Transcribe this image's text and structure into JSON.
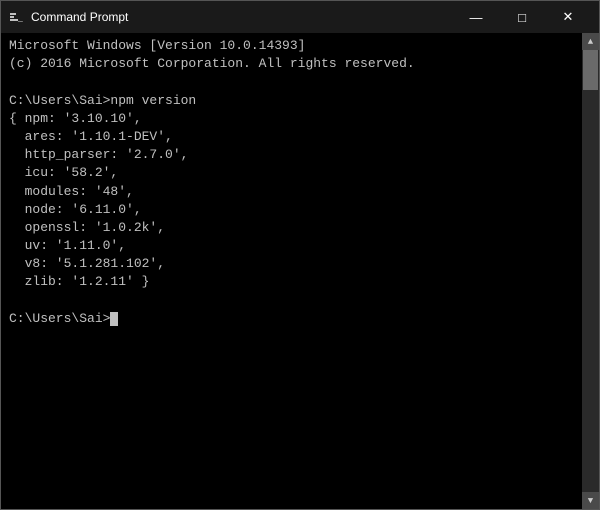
{
  "window": {
    "title": "Command Prompt",
    "controls": {
      "minimize": "—",
      "maximize": "□",
      "close": "✕"
    }
  },
  "terminal": {
    "lines": [
      "Microsoft Windows [Version 10.0.14393]",
      "(c) 2016 Microsoft Corporation. All rights reserved.",
      "",
      "C:\\Users\\Sai>npm version",
      "{ npm: '3.10.10',",
      "  ares: '1.10.1-DEV',",
      "  http_parser: '2.7.0',",
      "  icu: '58.2',",
      "  modules: '48',",
      "  node: '6.11.0',",
      "  openssl: '1.0.2k',",
      "  uv: '1.11.0',",
      "  v8: '5.1.281.102',",
      "  zlib: '1.2.11' }",
      "",
      "C:\\Users\\Sai>"
    ],
    "prompt": "C:\\Users\\Sai>"
  }
}
